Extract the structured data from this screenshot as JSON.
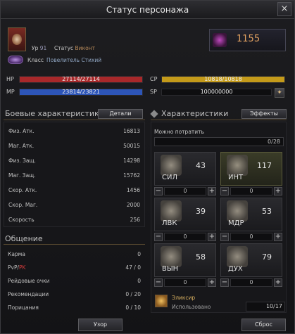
{
  "window": {
    "title": "Статус персонажа",
    "close_glyph": "×"
  },
  "header": {
    "level_label": "Ур",
    "level": "91",
    "status_label": "Статус",
    "status": "Виконт",
    "class_label": "Класс",
    "class": "Повелитель Стихий",
    "skill_points": "1155"
  },
  "bars": {
    "hp": {
      "label": "HP",
      "text": "27114/27114",
      "fraction": 1.0,
      "color": "#a8282a"
    },
    "mp": {
      "label": "MP",
      "text": "23814/23821",
      "fraction": 0.9997,
      "color": "#2d55b8"
    },
    "cp": {
      "label": "CP",
      "text": "10818/10818",
      "fraction": 1.0,
      "color": "#c49a1a"
    },
    "sp": {
      "label": "SP",
      "text": "100000000"
    }
  },
  "combat": {
    "title": "Боевые характеристики",
    "details_label": "Детали",
    "rows": [
      {
        "k": "Физ. Атк.",
        "v": "16813"
      },
      {
        "k": "Маг. Атк.",
        "v": "50015"
      },
      {
        "k": "Физ. Защ.",
        "v": "14298"
      },
      {
        "k": "Маг. Защ.",
        "v": "15762"
      },
      {
        "k": "Скор. Атк.",
        "v": "1456"
      },
      {
        "k": "Скор. Маг.",
        "v": "2000"
      },
      {
        "k": "Скорость",
        "v": "256"
      }
    ]
  },
  "communication": {
    "title": "Общение",
    "rows": [
      {
        "k": "Карма",
        "v": "0"
      },
      {
        "k_a": "PvP",
        "k_sep": "/",
        "k_b": "PK",
        "v": "47 / 0"
      },
      {
        "k": "Рейдовые очки",
        "v": "0"
      },
      {
        "k": "Рекомендации",
        "v": "0 / 20"
      },
      {
        "k": "Порицания",
        "v": "0 / 10"
      }
    ]
  },
  "attributes": {
    "title": "Характеристики",
    "effects_label": "Эффекты",
    "available_label": "Можно потратить",
    "available_value": "0/28",
    "stats": [
      {
        "name": "СИЛ",
        "value": "43",
        "alloc": "0"
      },
      {
        "name": "ИНТ",
        "value": "117",
        "alloc": "0"
      },
      {
        "name": "ЛВК",
        "value": "39",
        "alloc": "0"
      },
      {
        "name": "МДР",
        "value": "53",
        "alloc": "0"
      },
      {
        "name": "ВЫН",
        "value": "58",
        "alloc": "0"
      },
      {
        "name": "ДУХ",
        "value": "79",
        "alloc": "0"
      }
    ],
    "stepper_minus": "−",
    "stepper_plus": "+",
    "elixir_name": "Эликсир",
    "elixir_used_label": "Использовано",
    "elixir_used_value": "10/17"
  },
  "footer": {
    "pattern_label": "Узор",
    "reset_label": "Сброс"
  },
  "icons": {
    "exp_glyph": "✦"
  }
}
